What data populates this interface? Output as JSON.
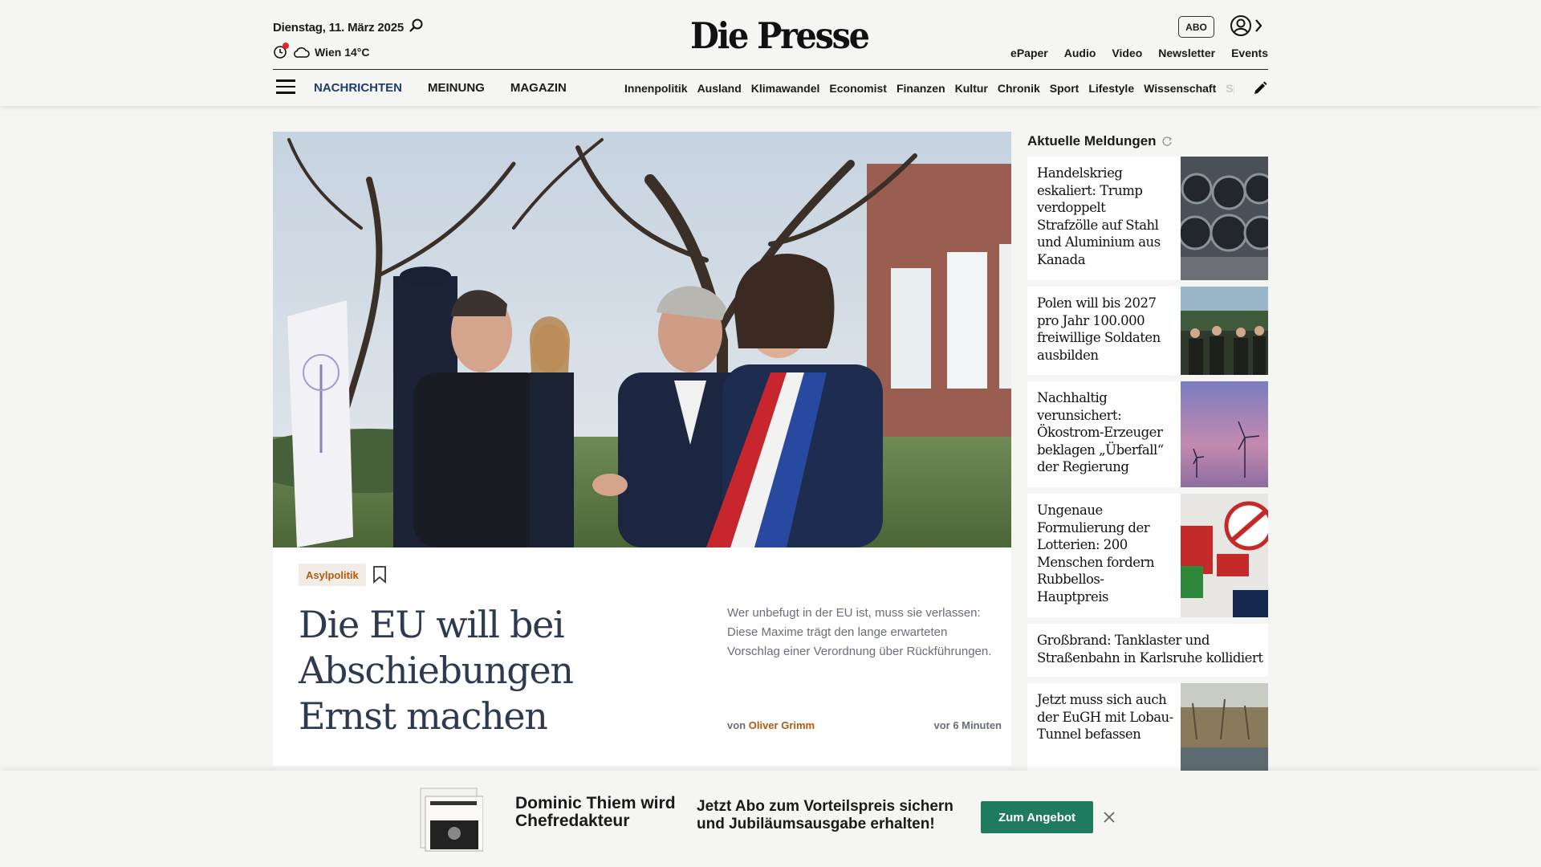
{
  "header": {
    "date": "Dienstag, 11. März 2025",
    "weather": "Wien 14°C",
    "logo": "Die Presse",
    "abo": "ABO",
    "top_links": [
      "ePaper",
      "Audio",
      "Video",
      "Newsletter",
      "Events"
    ]
  },
  "nav": {
    "main": [
      "NACHRICHTEN",
      "MEINUNG",
      "MAGAZIN"
    ],
    "sub": [
      "Innenpolitik",
      "Ausland",
      "Klimawandel",
      "Economist",
      "Finanzen",
      "Kultur",
      "Chronik",
      "Sport",
      "Lifestyle",
      "Wissenschaft",
      "Spectrum"
    ]
  },
  "hero": {
    "tag": "Asylpolitik",
    "headline": "Die EU will bei Abschiebungen Ernst machen",
    "lead": "Wer unbefugt in der EU ist, muss sie verlassen: Diese Maxime trägt den lange erwarteten Vorschlag einer Verordnung über Rückführungen.",
    "by_prefix": "von ",
    "author": "Oliver Grimm",
    "time": "vor 6 Minuten"
  },
  "sidebar": {
    "title": "Aktuelle Meldungen",
    "items": [
      {
        "text": "Handelskrieg eskaliert: Trump verdoppelt Strafzölle auf Stahl und Aluminium aus Kanada",
        "thumb": "steel-coils-image"
      },
      {
        "text": "Polen will bis 2027 pro Jahr 100.000 freiwillige Soldaten ausbilden",
        "thumb": "soldiers-image"
      },
      {
        "text": "Nachhaltig verunsichert: Ökostrom-Erzeuger beklagen „Überfall“ der Regierung",
        "thumb": "wind-turbines-image"
      },
      {
        "text": "Ungenaue Formulierung der Lotterien: 200 Menschen fordern Rubbellos-Hauptpreis",
        "thumb": "lotto-shop-image"
      },
      {
        "text": "Großbrand: Tanklaster und Straßenbahn in Karlsruhe kollidiert",
        "thumb": ""
      },
      {
        "text": "Jetzt muss sich auch der EuGH mit Lobau-Tunnel befassen",
        "thumb": "lobau-wetland-image"
      }
    ]
  },
  "promo": {
    "text1": "Dominic Thiem wird Chefredakteur",
    "text2": "Jetzt Abo zum Vorteilspreis sichern und Jubiläumsausgabe erhalten!",
    "button": "Zum Angebot"
  },
  "colors": {
    "accent_blue": "#1d3d6b",
    "tag_orange": "#b35a10",
    "button_green": "#1f7a5e",
    "headline_navy": "#2d3a4f"
  }
}
